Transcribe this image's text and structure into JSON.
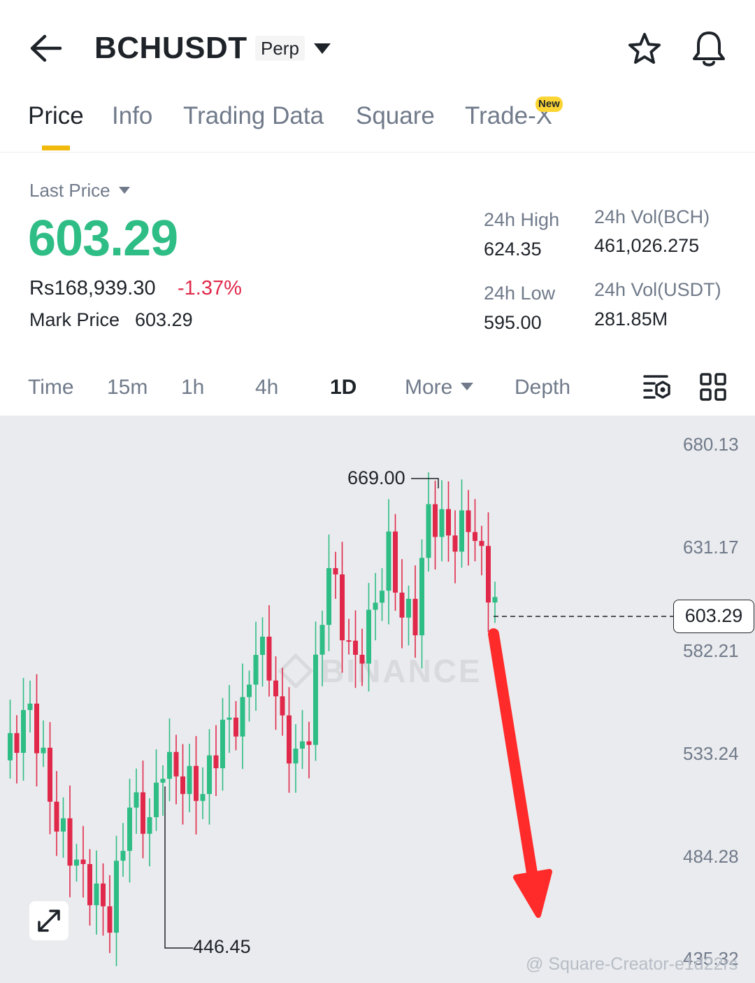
{
  "header": {
    "symbol": "BCHUSDT",
    "contract_badge": "Perp"
  },
  "tabs": [
    {
      "label": "Price",
      "active": true
    },
    {
      "label": "Info",
      "active": false
    },
    {
      "label": "Trading Data",
      "active": false
    },
    {
      "label": "Square",
      "active": false
    },
    {
      "label": "Trade-X",
      "active": false,
      "badge": "New"
    }
  ],
  "summary": {
    "last_price_label": "Last Price",
    "last_price": "603.29",
    "fiat_value": "Rs168,939.30",
    "change_percent": "-1.37%",
    "mark_price_label": "Mark Price",
    "mark_price": "603.29",
    "high_label": "24h High",
    "high_value": "624.35",
    "low_label": "24h Low",
    "low_value": "595.00",
    "vol_base_label": "24h Vol(BCH)",
    "vol_base_value": "461,026.275",
    "vol_quote_label": "24h Vol(USDT)",
    "vol_quote_value": "281.85M"
  },
  "intervals": {
    "time": "Time",
    "m15": "15m",
    "h1": "1h",
    "h4": "4h",
    "d1": "1D",
    "more": "More",
    "depth": "Depth",
    "active": "1D"
  },
  "chart": {
    "y_axis_labels": [
      "680.13",
      "631.17",
      "582.21",
      "533.24",
      "484.28",
      "435.32"
    ],
    "current_price_tag": "603.29",
    "high_annotation": "669.00",
    "low_annotation": "446.45",
    "watermark": "BINANCE",
    "source_text": "@ Square-Creator-e1d22rs"
  },
  "colors": {
    "up": "#2ebd85",
    "down": "#e0294a",
    "accent": "#f0b90b",
    "arrow": "#ff2a2a"
  },
  "icons": [
    "arrow-left-icon",
    "caret-down-icon",
    "star-icon",
    "bell-icon",
    "chart-settings-icon",
    "grid-icon",
    "expand-icon"
  ]
}
